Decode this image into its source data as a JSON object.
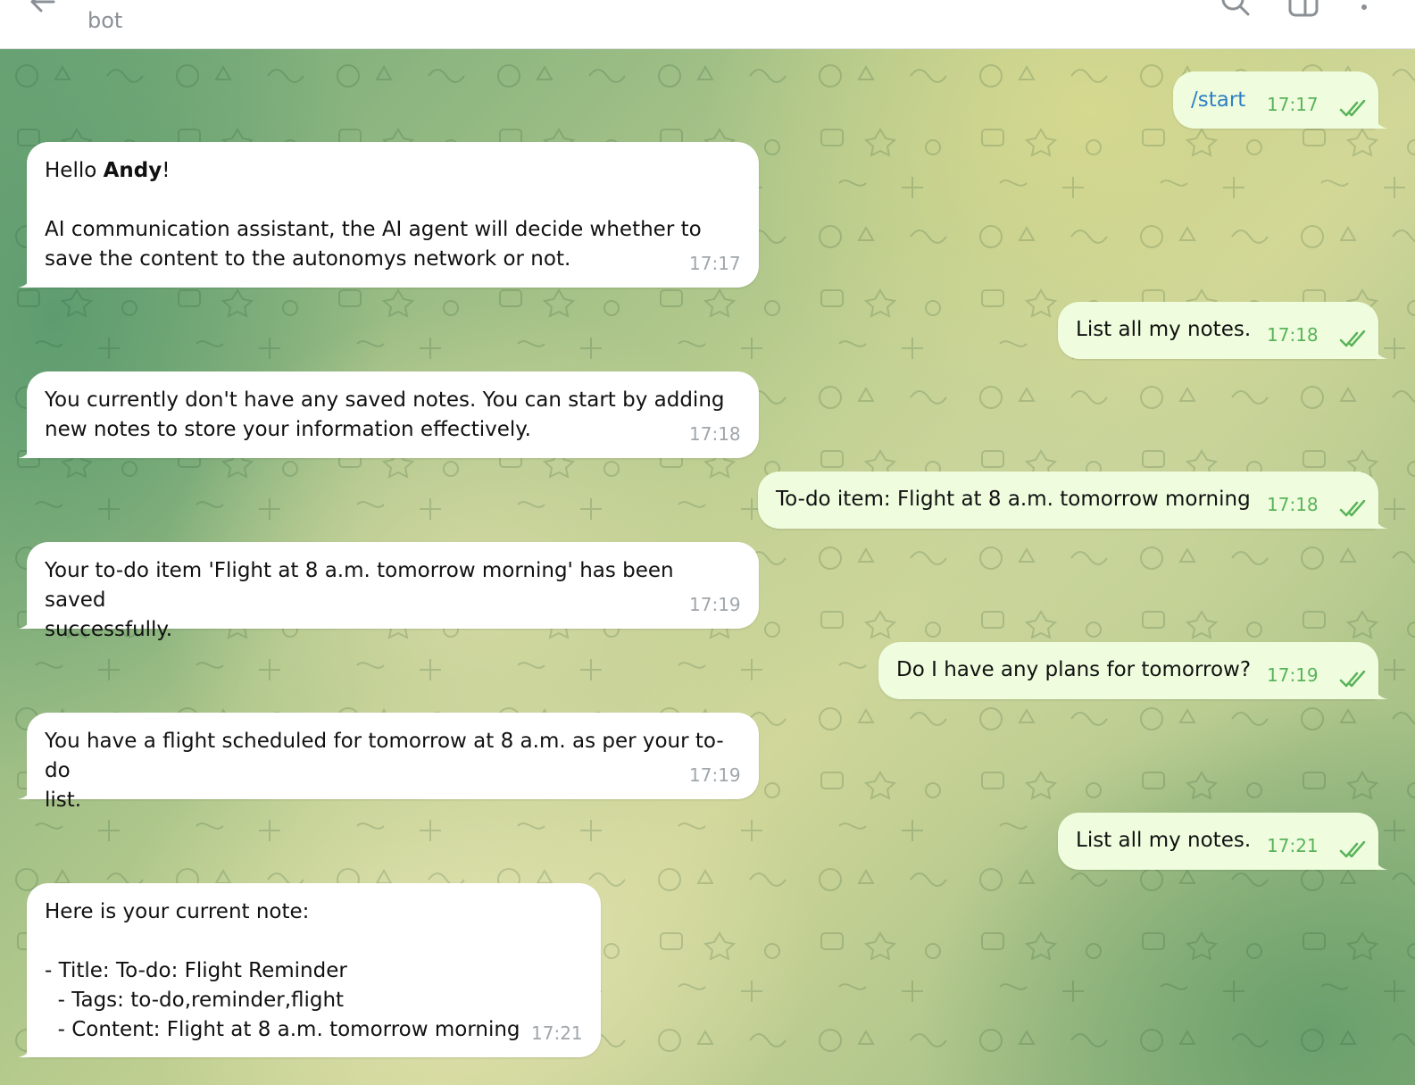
{
  "header": {
    "subtitle": "bot",
    "icons": [
      "back-arrow-icon",
      "search-icon",
      "layout-icon",
      "more-vertical-icon"
    ]
  },
  "colors": {
    "incoming_bubble": "#ffffff",
    "outgoing_bubble": "#effdde",
    "outgoing_time": "#59b35a",
    "incoming_time": "#a0a6ab",
    "command_link": "#2e7fc3"
  },
  "messages": [
    {
      "dir": "out",
      "text": "/start",
      "time": "17:17",
      "status": "read"
    },
    {
      "dir": "in",
      "greeting_pre": "Hello ",
      "greeting_name": "Andy",
      "greeting_post": "!",
      "text": "AI communication assistant, the AI agent will decide whether to\nsave the content to the autonomys network or not.",
      "time": "17:17"
    },
    {
      "dir": "out",
      "text": "List all my notes.",
      "time": "17:18",
      "status": "read"
    },
    {
      "dir": "in",
      "text": "You currently don't have any saved notes. You can start by adding\nnew notes to store your information effectively.",
      "time": "17:18"
    },
    {
      "dir": "out",
      "text": "To-do item: Flight at 8 a.m. tomorrow morning",
      "time": "17:18",
      "status": "read"
    },
    {
      "dir": "in",
      "text": "Your to-do item 'Flight at 8 a.m. tomorrow morning' has been saved\nsuccessfully.",
      "time": "17:19"
    },
    {
      "dir": "out",
      "text": "Do I have any plans for tomorrow?",
      "time": "17:19",
      "status": "read"
    },
    {
      "dir": "in",
      "text": "You have a flight scheduled for tomorrow at 8 a.m. as per your to-do\nlist.",
      "time": "17:19"
    },
    {
      "dir": "out",
      "text": "List all my notes.",
      "time": "17:21",
      "status": "read"
    },
    {
      "dir": "in",
      "text": "Here is your current note:\n\n- Title: To-do: Flight Reminder\n  - Tags: to-do,reminder,flight\n  - Content: Flight at 8 a.m. tomorrow morning",
      "time": "17:21"
    }
  ]
}
